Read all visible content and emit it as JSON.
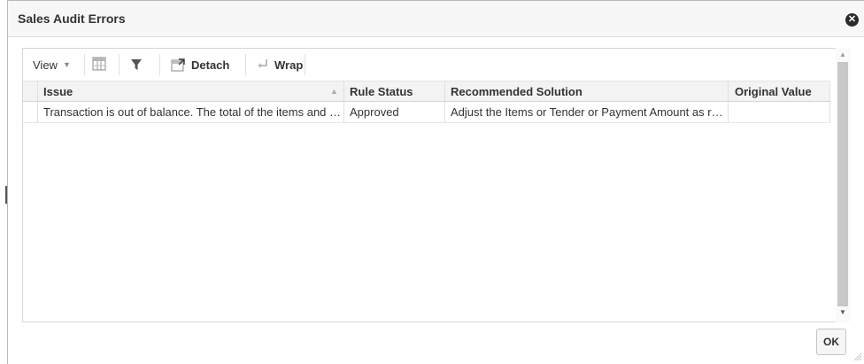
{
  "dialog": {
    "title": "Sales Audit Errors",
    "close_icon": "close-icon",
    "ok_label": "OK"
  },
  "toolbar": {
    "view_label": "View",
    "freeze_icon": "freeze-columns-icon",
    "filter_icon": "filter-icon",
    "detach_label": "Detach",
    "wrap_label": "Wrap"
  },
  "table": {
    "columns": [
      "Issue",
      "Rule Status",
      "Recommended Solution",
      "Original Value"
    ],
    "rows": [
      {
        "issue": "Transaction is out of balance. The total of the items and pa…",
        "rule_status": "Approved",
        "recommended_solution": "Adjust the Items or Tender or Payment Amount as req…",
        "original_value": ""
      }
    ]
  }
}
